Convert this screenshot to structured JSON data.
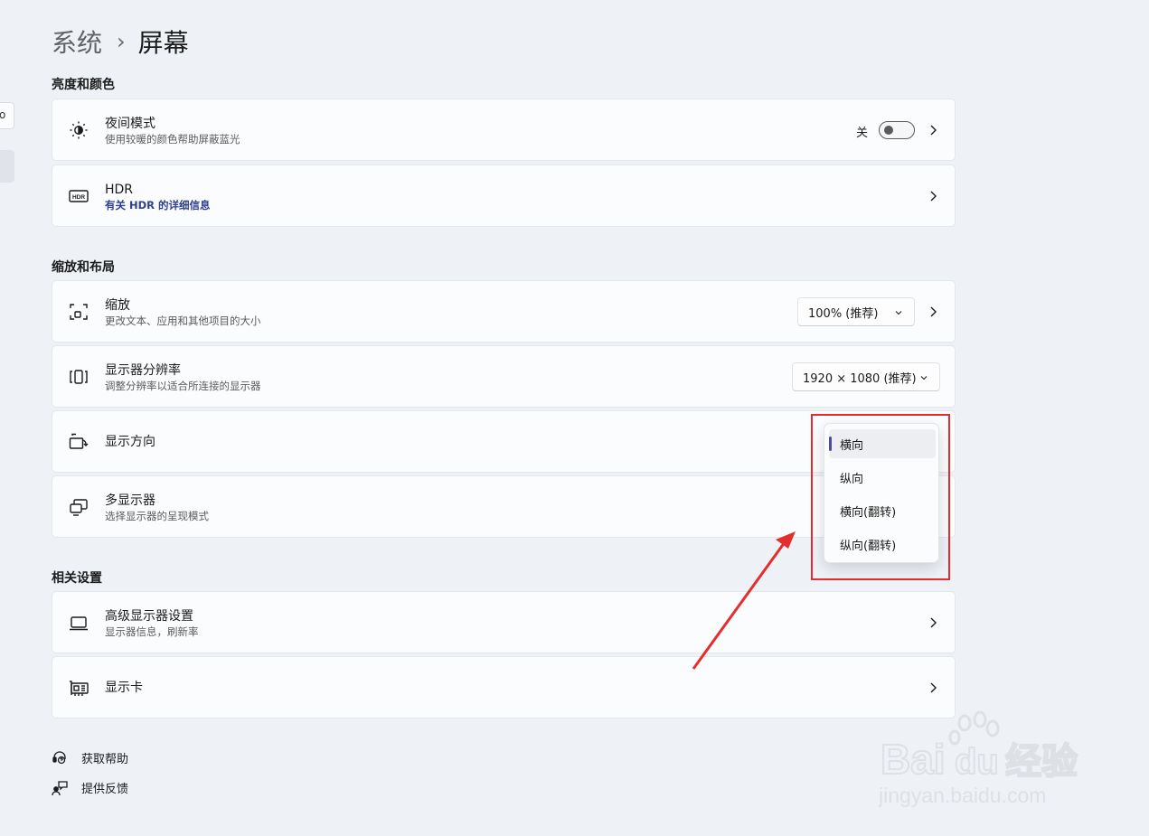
{
  "left_pane": {
    "search_fragment": "o"
  },
  "breadcrumb": {
    "parent": "系统",
    "separator": "›",
    "current": "屏幕"
  },
  "sections": {
    "brightness_color": "亮度和颜色",
    "scale_layout": "缩放和布局",
    "related": "相关设置"
  },
  "night_light": {
    "title": "夜间模式",
    "subtitle": "使用较暖的颜色帮助屏蔽蓝光",
    "toggle_label": "关",
    "toggle_on": false,
    "icon": "night-light-icon"
  },
  "hdr": {
    "title": "HDR",
    "link": "有关 HDR 的详细信息",
    "icon": "hdr-icon"
  },
  "scale": {
    "title": "缩放",
    "subtitle": "更改文本、应用和其他项目的大小",
    "value": "100% (推荐)",
    "icon": "scale-icon"
  },
  "resolution": {
    "title": "显示器分辨率",
    "subtitle": "调整分辨率以适合所连接的显示器",
    "value": "1920 × 1080 (推荐)",
    "icon": "resolution-icon"
  },
  "orientation": {
    "title": "显示方向",
    "icon": "orientation-icon",
    "options": [
      "横向",
      "纵向",
      "横向(翻转)",
      "纵向(翻转)"
    ],
    "selected": "横向"
  },
  "multi_display": {
    "title": "多显示器",
    "subtitle": "选择显示器的呈现模式",
    "icon": "multi-display-icon"
  },
  "advanced_display": {
    "title": "高级显示器设置",
    "subtitle": "显示器信息，刷新率",
    "icon": "laptop-icon"
  },
  "graphics": {
    "title": "显示卡",
    "icon": "graphics-card-icon"
  },
  "footer": {
    "help": "获取帮助",
    "feedback": "提供反馈"
  },
  "annotation": {
    "highlight_color": "#e52d2d"
  },
  "watermark": {
    "brand": "Bai",
    "brand2": "du",
    "suffix": "经验",
    "url": "jingyan.baidu.com"
  },
  "colors": {
    "accent": "#4a4d9c",
    "link": "#2d3f8f",
    "background": "#eef2f7",
    "card": "#fbfcfd"
  }
}
